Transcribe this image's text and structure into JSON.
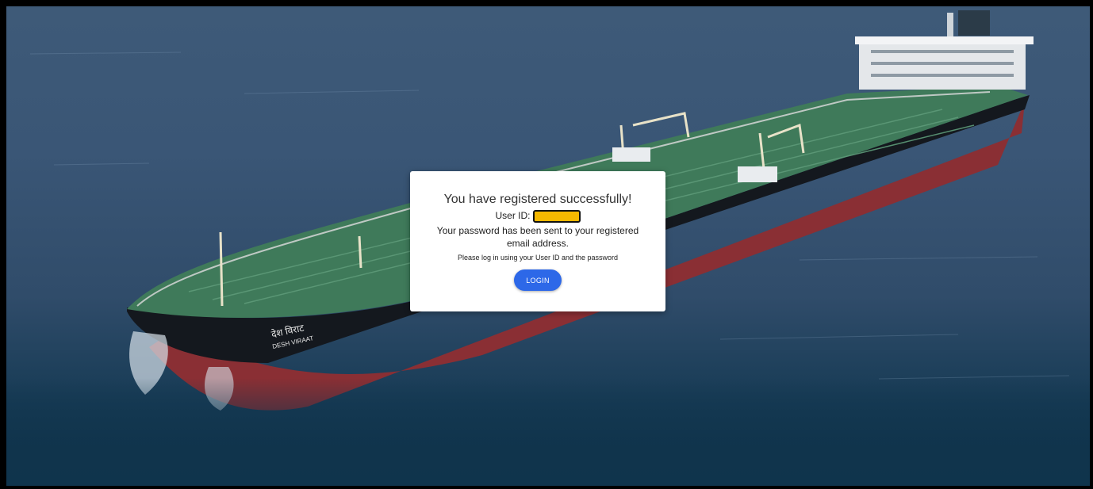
{
  "background": {
    "ship_name_hindi": "देश विराट",
    "ship_name": "DESH VIRAAT"
  },
  "dialog": {
    "title": "You have registered successfully!",
    "user_id_label": "User ID:",
    "user_id_value": "",
    "password_message": "Your password has been sent to your registered email address.",
    "login_note": "Please log in using your User ID and the password",
    "login_button": "LOGIN"
  },
  "colors": {
    "login_button": "#2d68e8",
    "redaction": "#f5b800"
  }
}
